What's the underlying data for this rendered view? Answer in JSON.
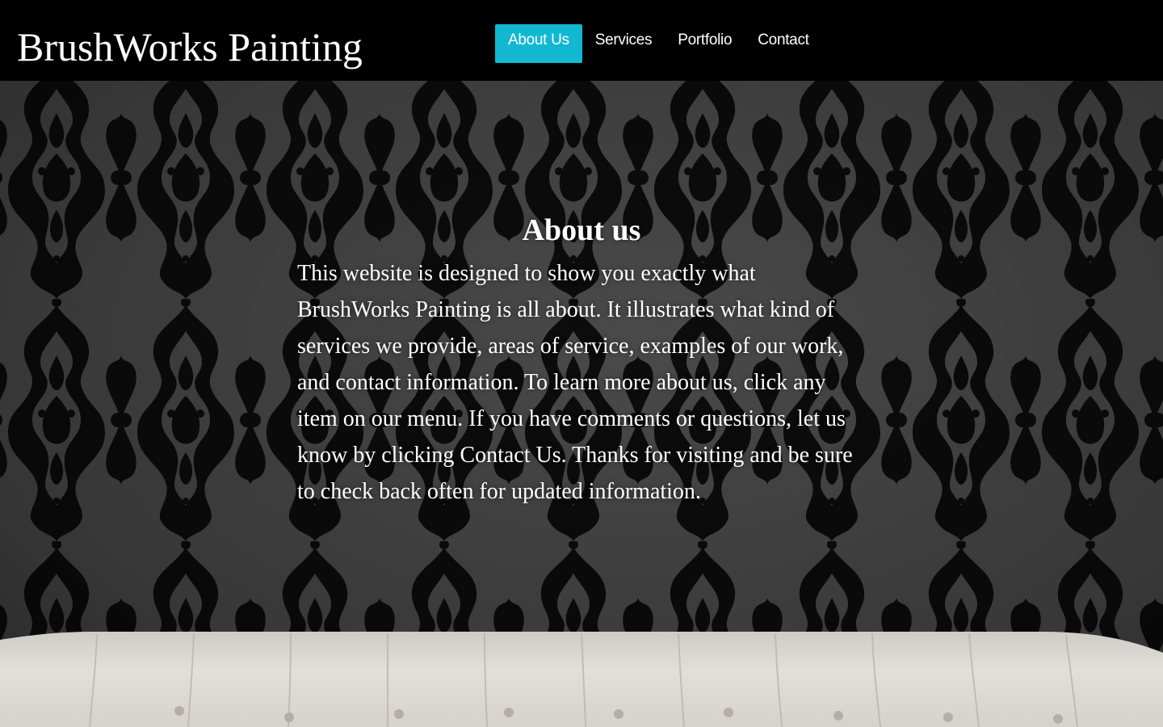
{
  "header": {
    "brand": "BrushWorks Painting",
    "nav": [
      {
        "label": "About Us",
        "active": true
      },
      {
        "label": "Services",
        "active": false
      },
      {
        "label": "Portfolio",
        "active": false
      },
      {
        "label": "Contact",
        "active": false
      }
    ]
  },
  "about": {
    "title": "About us",
    "body": "This website is designed to show you exactly what BrushWorks Painting is all about. It illustrates what kind of services we provide, areas of service, examples of our work, and contact information. To learn more about us, click any item on our menu. If you have comments or questions, let us know by clicking Contact Us. Thanks for visiting and be sure to check back often for updated information."
  },
  "colors": {
    "header_bg": "#000000",
    "active_nav_bg": "#12b8d2",
    "text": "#ffffff",
    "wallpaper_base": "#4a4949",
    "damask": "#0b0b0b",
    "sofa": "#d9d6d2"
  },
  "hero": {
    "background": "black damask wallpaper with white tufted sofa"
  }
}
